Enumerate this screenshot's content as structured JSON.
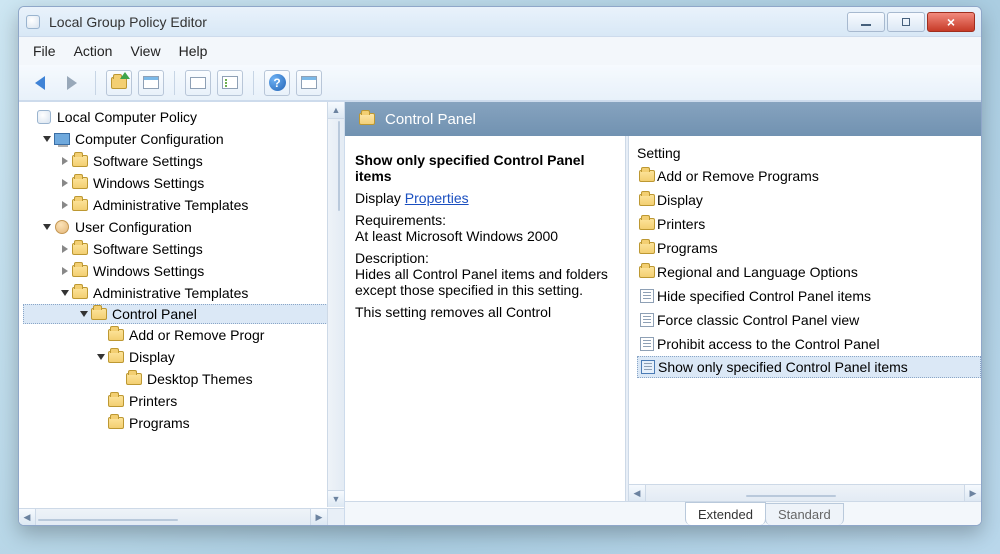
{
  "window": {
    "title": "Local Group Policy Editor"
  },
  "menu": {
    "file": "File",
    "action": "Action",
    "view": "View",
    "help": "Help"
  },
  "tree": {
    "root": "Local Computer Policy",
    "cc": "Computer Configuration",
    "cc_sw": "Software Settings",
    "cc_win": "Windows Settings",
    "cc_admin": "Administrative Templates",
    "uc": "User Configuration",
    "uc_sw": "Software Settings",
    "uc_win": "Windows Settings",
    "uc_admin": "Administrative Templates",
    "cp": "Control Panel",
    "cp_arp": "Add or Remove Progr",
    "cp_display": "Display",
    "cp_desktopthemes": "Desktop Themes",
    "cp_printers": "Printers",
    "cp_programs": "Programs"
  },
  "rightHeader": {
    "title": "Control Panel"
  },
  "detail": {
    "title": "Show only specified Control Panel items",
    "display_label": "Display",
    "properties_link": "Properties",
    "requirements_label": "Requirements:",
    "requirements_text": "At least Microsoft Windows 2000",
    "description_label": "Description:",
    "description_text": "Hides all Control Panel items and folders except those specified in this setting.",
    "description_more": "This setting removes all Control"
  },
  "listing": {
    "header": "Setting",
    "items": [
      {
        "type": "folder",
        "label": "Add or Remove Programs"
      },
      {
        "type": "folder",
        "label": "Display"
      },
      {
        "type": "folder",
        "label": "Printers"
      },
      {
        "type": "folder",
        "label": "Programs"
      },
      {
        "type": "folder",
        "label": "Regional and Language Options"
      },
      {
        "type": "setting",
        "label": "Hide specified Control Panel items"
      },
      {
        "type": "setting",
        "label": "Force classic Control Panel view"
      },
      {
        "type": "setting",
        "label": "Prohibit access to the Control Panel"
      },
      {
        "type": "setting",
        "label": "Show only specified Control Panel items",
        "selected": true
      }
    ]
  },
  "tabs": {
    "extended": "Extended",
    "standard": "Standard"
  }
}
